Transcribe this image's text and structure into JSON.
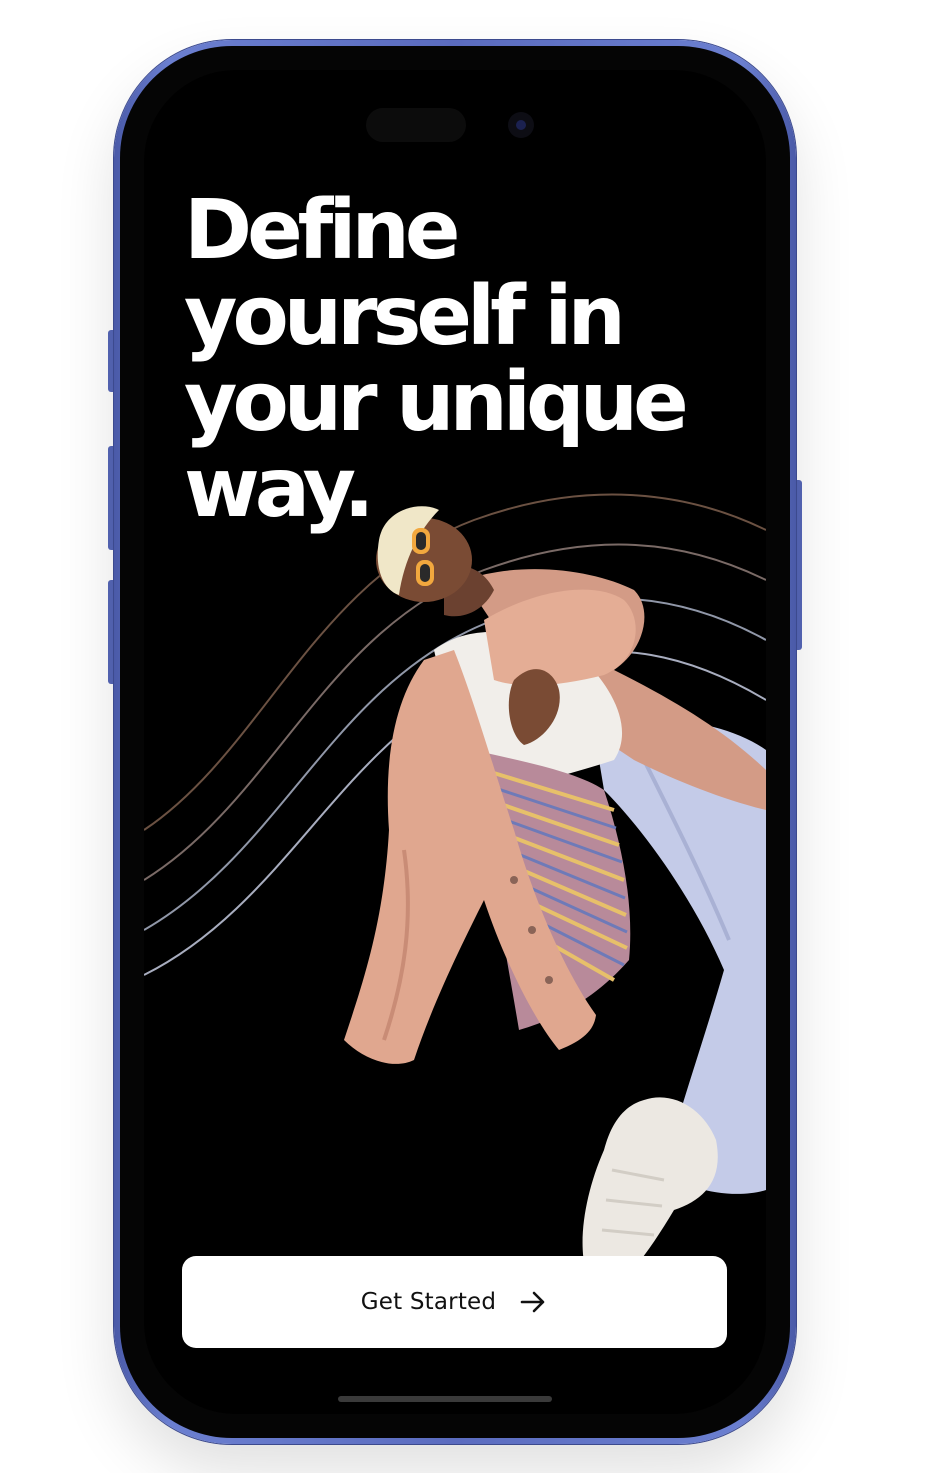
{
  "onboarding": {
    "headline_line1": "Define",
    "headline_line2": "yourself in",
    "headline_line3": "your unique",
    "headline_line4": "way.",
    "cta_label": "Get Started"
  },
  "icons": {
    "cta": "arrow-right-icon"
  },
  "colors": {
    "screen_background": "#000000",
    "text_primary": "#ffffff",
    "button_background": "#ffffff",
    "button_text": "#111111",
    "frame": "#5b6cbf",
    "coat": "#e0a78f",
    "pants": "#c4cbe8",
    "shoes": "#ece8e2"
  }
}
